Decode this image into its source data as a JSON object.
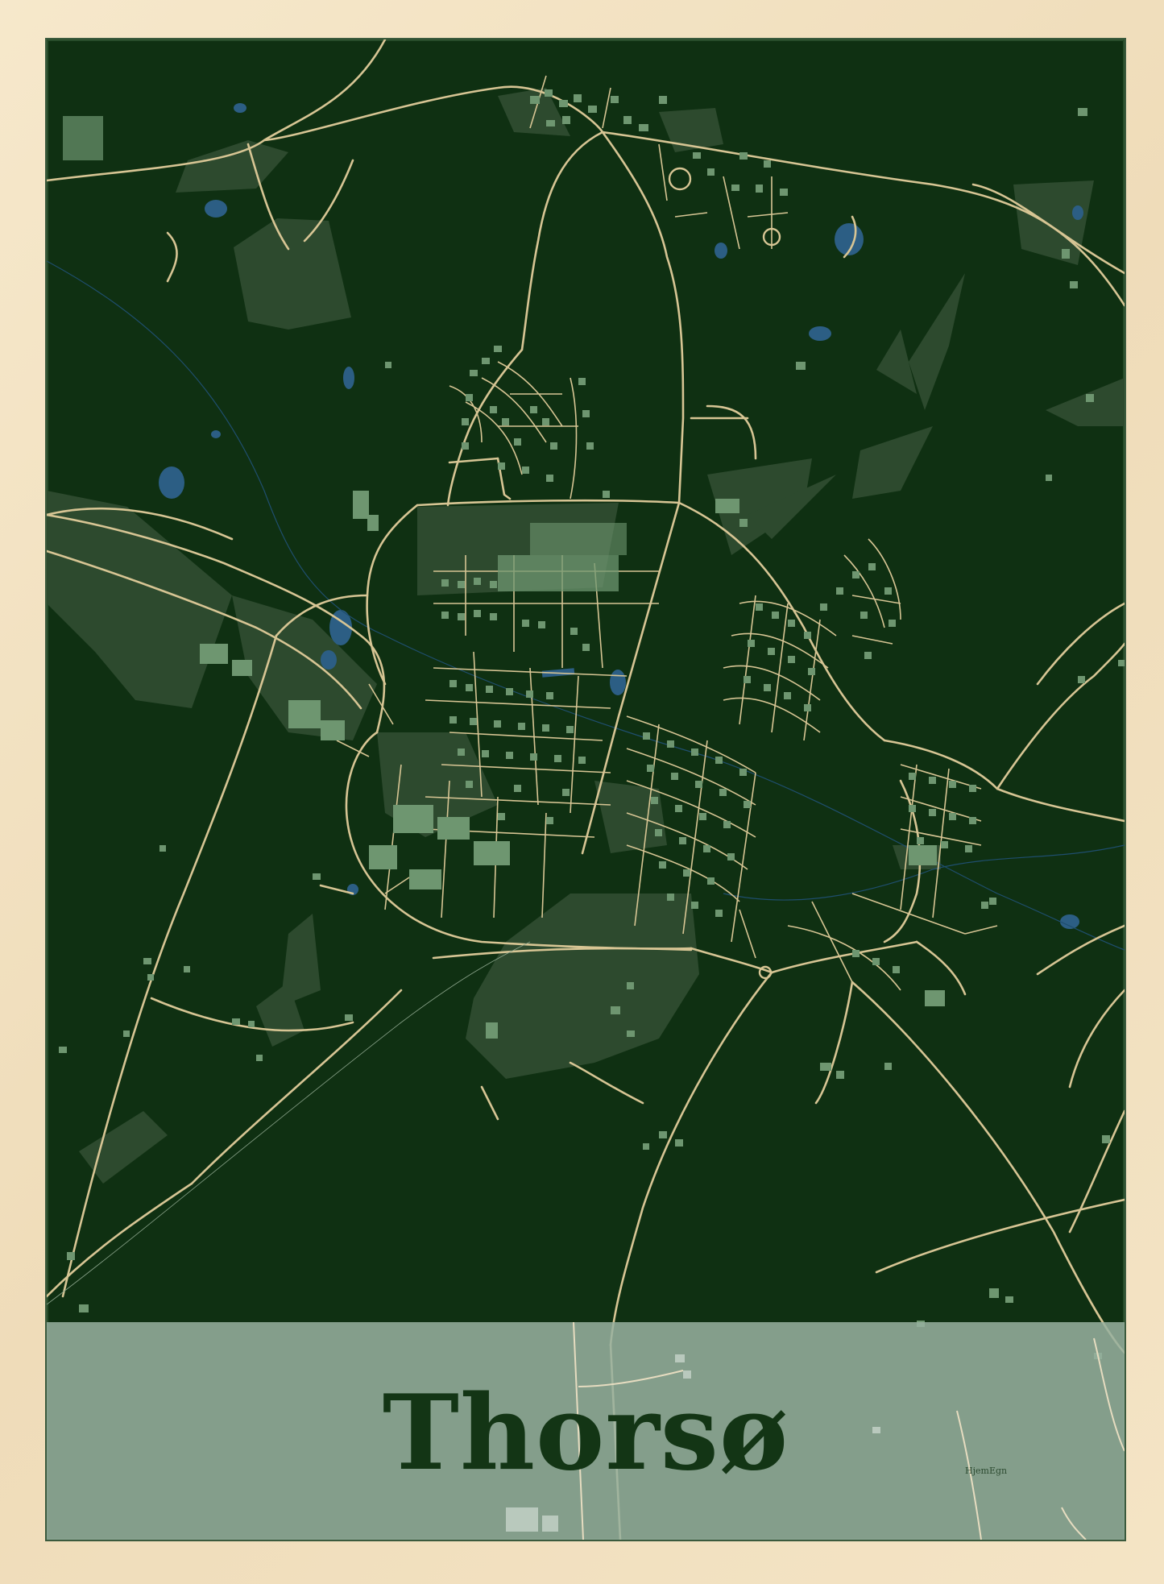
{
  "poster": {
    "city_name": "Thorsø",
    "brand": "HjemEgn"
  },
  "colors": {
    "frame_wood": "#f3e3c4",
    "map_background": "#0f3012",
    "roads": "#d7c594",
    "buildings": "#6e9670",
    "land_patches": "#2d4a2e",
    "water": "#2c5e84",
    "label_band": "#97b19f",
    "title_text": "#133515"
  },
  "icons": {
    "roundabout": "circle-outline"
  }
}
